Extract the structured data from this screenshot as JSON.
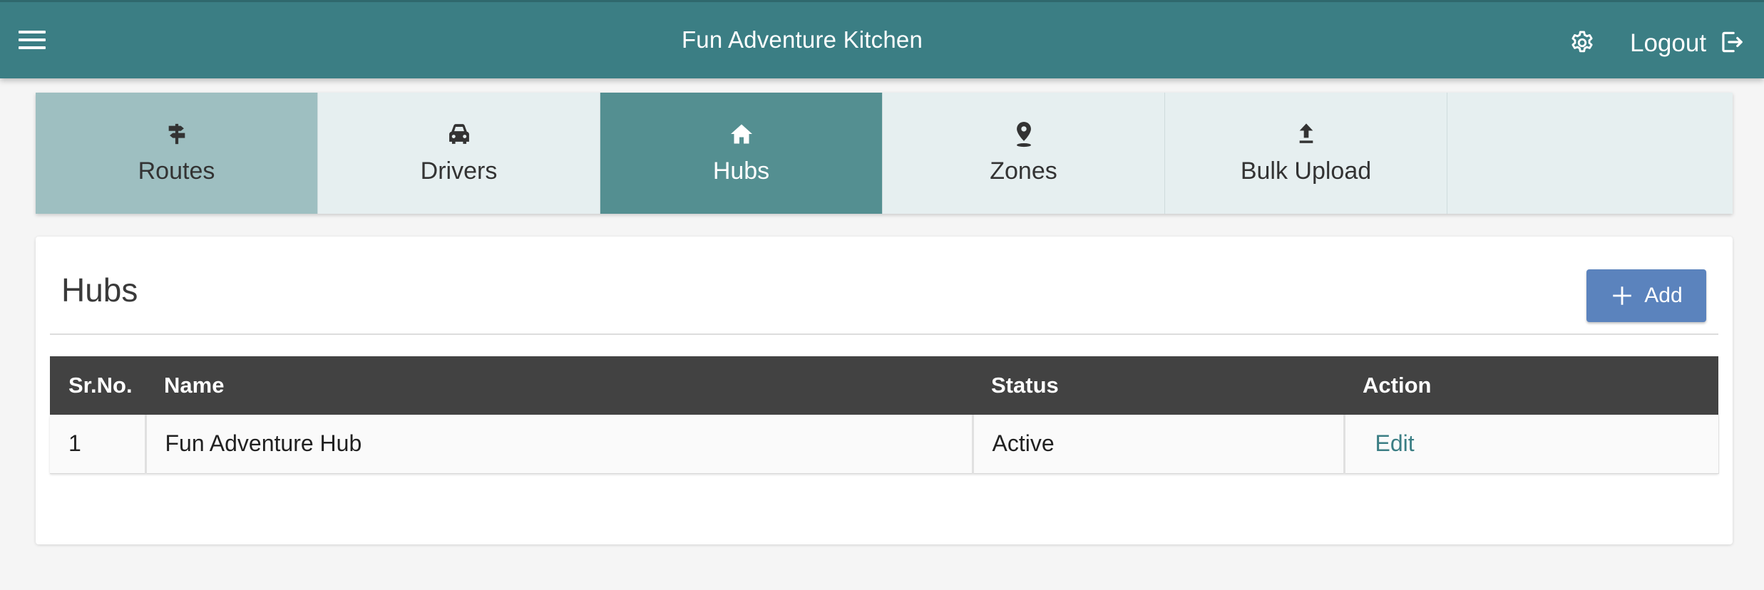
{
  "header": {
    "app_title": "Fun Adventure Kitchen",
    "logout_label": "Logout",
    "background_color": "#3b7e84"
  },
  "tabs": [
    {
      "label": "Routes",
      "icon": "signpost-icon"
    },
    {
      "label": "Drivers",
      "icon": "car-icon"
    },
    {
      "label": "Hubs",
      "icon": "home-icon",
      "selected": true
    },
    {
      "label": "Zones",
      "icon": "location-pin-icon"
    },
    {
      "label": "Bulk Upload",
      "icon": "upload-icon"
    }
  ],
  "hubs": {
    "title": "Hubs",
    "add_label": "Add",
    "add_button_color": "#5b83bd",
    "columns": [
      "Sr.No.",
      "Name",
      "Status",
      "Action"
    ],
    "rows": [
      {
        "sr_no": "1",
        "name": "Fun Adventure Hub",
        "status": "Active",
        "action": "Edit"
      }
    ]
  }
}
